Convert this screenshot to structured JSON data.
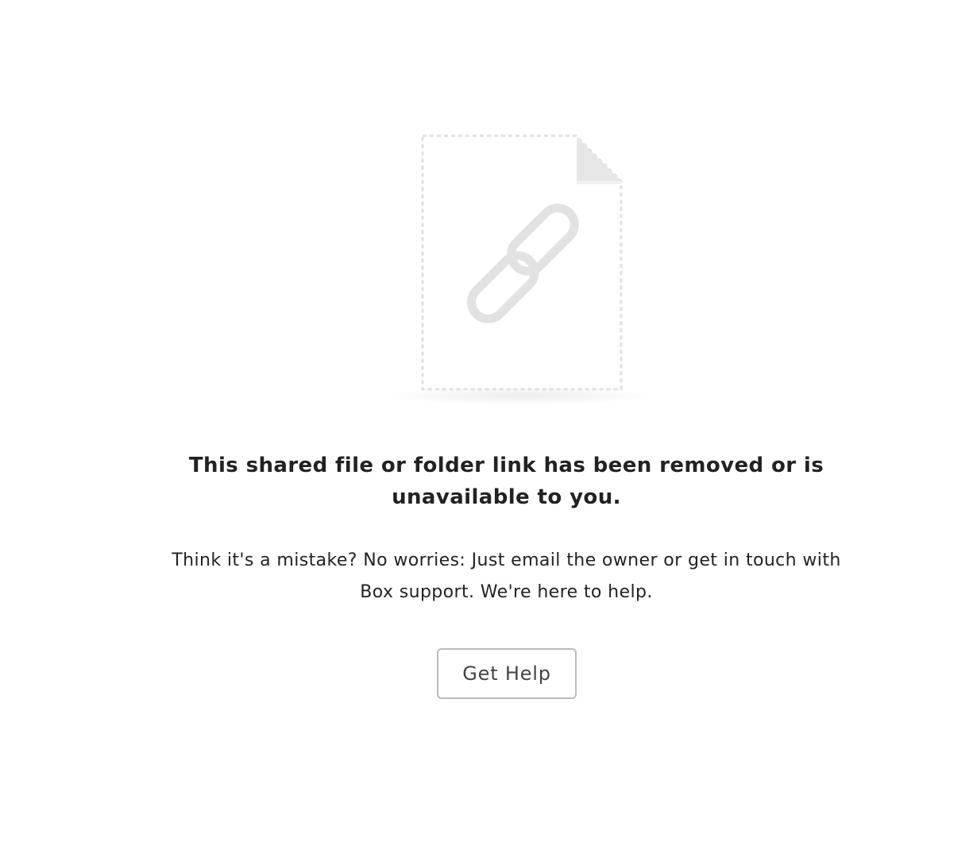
{
  "illustration": {
    "document_icon": "document-icon",
    "link_icon": "link-icon",
    "colors": {
      "outline": "#e0e0e0",
      "fold": "#e6e6e6",
      "link": "#e2e2e2"
    }
  },
  "error": {
    "headline": "This shared file or folder link has been removed or is unavailable to you.",
    "message": "Think it's a mistake? No worries: Just email the owner or get in touch with Box support. We're here to help."
  },
  "actions": {
    "get_help_label": "Get Help"
  }
}
